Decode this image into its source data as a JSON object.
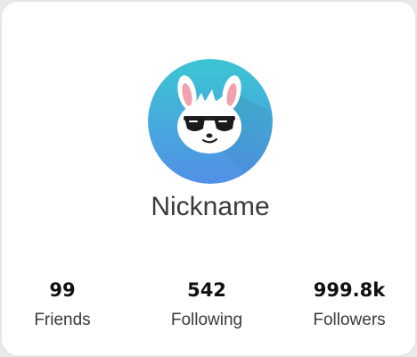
{
  "profile": {
    "avatar_icon": "bunny-sunglasses-avatar",
    "nickname": "Nickname"
  },
  "stats": [
    {
      "value": "99",
      "label": "Friends"
    },
    {
      "value": "542",
      "label": "Following"
    },
    {
      "value": "999.8k",
      "label": "Followers"
    }
  ],
  "colors": {
    "avatar_gradient_start": "#37c3d6",
    "avatar_gradient_end": "#4f8fe6",
    "text": "#3b3b3b"
  }
}
